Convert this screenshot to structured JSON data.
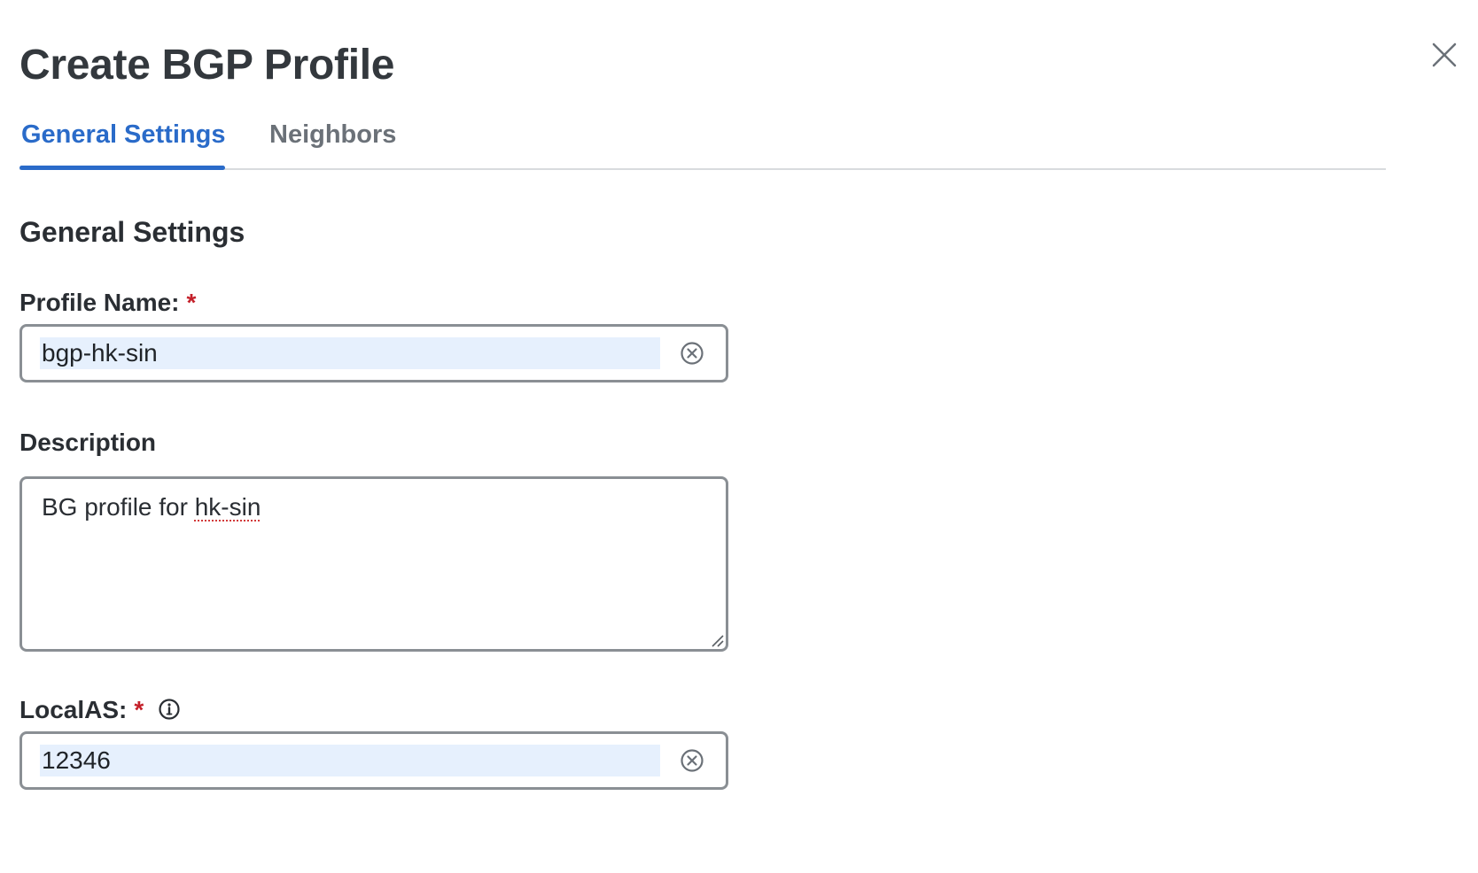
{
  "dialog": {
    "title": "Create BGP Profile",
    "close_icon": "close-icon"
  },
  "tabs": [
    {
      "label": "General Settings",
      "active": true
    },
    {
      "label": "Neighbors",
      "active": false
    }
  ],
  "section": {
    "heading": "General Settings"
  },
  "fields": {
    "profile_name": {
      "label": "Profile Name:",
      "required_mark": "*",
      "value": "bgp-hk-sin",
      "clear_icon": "clear-circle-icon"
    },
    "description": {
      "label": "Description",
      "value_prefix": "BG profile for ",
      "value_flagged_word": "hk-sin"
    },
    "local_as": {
      "label": "LocalAS:",
      "required_mark": "*",
      "info_icon": "info-icon",
      "value": "12346",
      "clear_icon": "clear-circle-icon"
    }
  },
  "colors": {
    "accent": "#2a6bc9",
    "required": "#c4202a",
    "input_highlight": "#e6f0fd",
    "border": "#8a8f94"
  }
}
